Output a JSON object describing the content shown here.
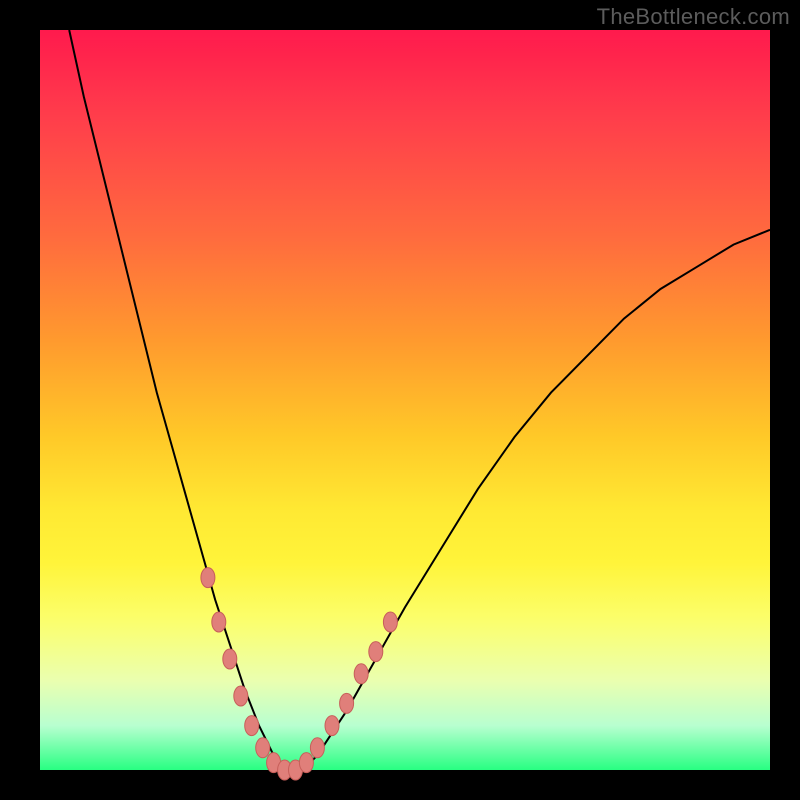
{
  "watermark": "TheBottleneck.com",
  "colors": {
    "curve_stroke": "#000000",
    "marker_fill": "#e07f7a",
    "marker_stroke": "#c75f5a",
    "background_black": "#000000"
  },
  "chart_data": {
    "type": "line",
    "title": "",
    "xlabel": "",
    "ylabel": "",
    "xlim": [
      0,
      100
    ],
    "ylim": [
      0,
      100
    ],
    "series": [
      {
        "name": "bottleneck-curve",
        "x": [
          4,
          6,
          8,
          10,
          12,
          14,
          16,
          18,
          20,
          22,
          24,
          26,
          28,
          30,
          32,
          34,
          36,
          38,
          42,
          46,
          50,
          55,
          60,
          65,
          70,
          75,
          80,
          85,
          90,
          95,
          100
        ],
        "y": [
          100,
          91,
          83,
          75,
          67,
          59,
          51,
          44,
          37,
          30,
          23,
          17,
          11,
          6,
          2,
          0,
          0,
          2,
          8,
          15,
          22,
          30,
          38,
          45,
          51,
          56,
          61,
          65,
          68,
          71,
          73
        ]
      }
    ],
    "markers": {
      "x": [
        23,
        24.5,
        26,
        27.5,
        29,
        30.5,
        32,
        33.5,
        35,
        36.5,
        38,
        40,
        42,
        44,
        46,
        48
      ],
      "y": [
        26,
        20,
        15,
        10,
        6,
        3,
        1,
        0,
        0,
        1,
        3,
        6,
        9,
        13,
        16,
        20
      ]
    }
  }
}
